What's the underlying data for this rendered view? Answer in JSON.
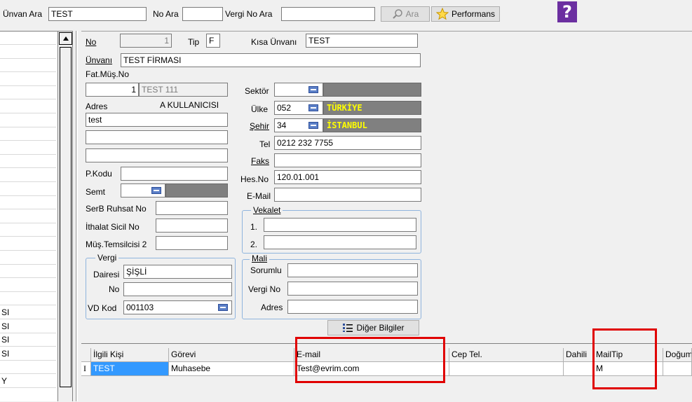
{
  "toolbar": {
    "unvan_ara_label": "Ünvan Ara",
    "unvan_ara_value": "TEST",
    "no_ara_label": "No Ara",
    "no_ara_value": "",
    "vergi_no_ara_label": "Vergi No Ara",
    "vergi_no_ara_value": "",
    "ara_button": "Ara",
    "performans_button": "Performans",
    "help_glyph": "?"
  },
  "left_list": {
    "rows": [
      "",
      "",
      "",
      "",
      "",
      "",
      "",
      "",
      "",
      "",
      "",
      "",
      "",
      "",
      "",
      "",
      "",
      "",
      "",
      "",
      "SI",
      "SI",
      "SI",
      "SI",
      "",
      "Y",
      ""
    ]
  },
  "form": {
    "no_label": "No",
    "no_value": "1",
    "tip_label": "Tip",
    "tip_value": "F",
    "kisa_unvan_label": "Kısa Ünvanı",
    "kisa_unvan_value": "TEST",
    "unvan_label": "Ünvanı",
    "unvan_value": "TEST FİRMASI",
    "fat_mus_no_label": "Fat.Müş.No",
    "fat_mus_no_value": "1",
    "fat_mus_name": "TEST 111",
    "adres_label": "Adres",
    "a_kullanicisi": "A KULLANICISI",
    "adres_line1": "test",
    "adres_line2": "",
    "adres_line3": "",
    "pkodu_label": "P.Kodu",
    "pkodu_value": "",
    "semt_label": "Semt",
    "semt_value": "",
    "serb_ruhsat_label": "SerB Ruhsat No",
    "serb_ruhsat_value": "",
    "ithalat_sicil_label": "İthalat Sicil No",
    "ithalat_sicil_value": "",
    "mus_temsilcisi_label": "Müş.Temsilcisi 2",
    "mus_temsilcisi_value": "",
    "sektor_label": "Sektör",
    "sektor_value": "",
    "ulke_label": "Ülke",
    "ulke_code": "052",
    "ulke_name": "TÜRKİYE",
    "sehir_label": "Şehir",
    "sehir_code": "34",
    "sehir_name": "İSTANBUL",
    "tel_label": "Tel",
    "tel_value": "0212 232 7755",
    "faks_label": "Faks",
    "faks_value": "",
    "hes_no_label": "Hes.No",
    "hes_no_value": "120.01.001",
    "email_label": "E-Mail",
    "email_value": "",
    "vekalet_title": "Vekalet",
    "vekalet_1_label": "1.",
    "vekalet_1_value": "",
    "vekalet_2_label": "2.",
    "vekalet_2_value": "",
    "vergi_title": "Vergi",
    "vergi_dairesi_label": "Dairesi",
    "vergi_dairesi_value": "ŞİŞLİ",
    "vergi_no_label": "No",
    "vergi_no_value": "",
    "vd_kod_label": "VD Kod",
    "vd_kod_value": "001103",
    "mali_title": "Mali",
    "mali_sorumlu_label": "Sorumlu",
    "mali_sorumlu_value": "",
    "mali_vergi_no_label": "Vergi No",
    "mali_vergi_no_value": "",
    "mali_adres_label": "Adres",
    "mali_adres_value": "",
    "diger_bilgiler_button": "Diğer Bilgiler"
  },
  "contacts_grid": {
    "headers": [
      "İlgili Kişi",
      "Görevi",
      "E-mail",
      "Cep Tel.",
      "Dahili",
      "MailTip",
      "Doğum"
    ],
    "rows": [
      {
        "indicator": "I",
        "ilgili_kisi": "TEST",
        "gorevi": "Muhasebe",
        "email": "Test@evrim.com",
        "cep_tel": "",
        "dahili": "",
        "mailtip": "M",
        "dogum": ""
      }
    ]
  },
  "colors": {
    "highlight_red": "#e00000",
    "selected_cell": "#3399ff",
    "dark_field": "#808080",
    "yellow_text": "#ffff00",
    "help_purple": "#6b2fa0"
  }
}
